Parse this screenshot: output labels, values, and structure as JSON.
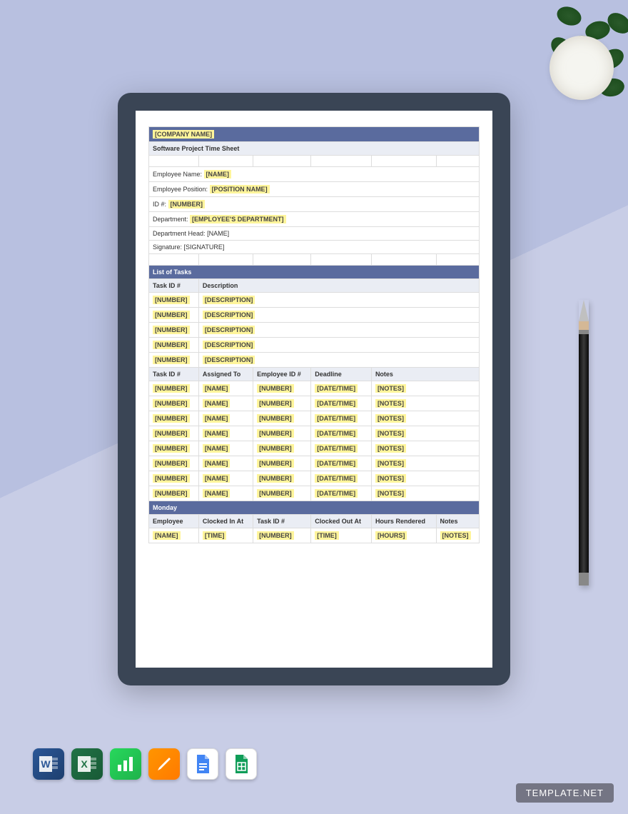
{
  "brand": "TEMPLATE.NET",
  "doc": {
    "company_placeholder": "[COMPANY NAME]",
    "title": "Software Project Time Sheet",
    "fields": [
      {
        "label": "Employee Name:",
        "value": "[NAME]"
      },
      {
        "label": "Employee Position:",
        "value": "[POSITION NAME]"
      },
      {
        "label": "ID #:",
        "value": "[NUMBER]"
      },
      {
        "label": "Department:",
        "value": "[EMPLOYEE'S DEPARTMENT]"
      },
      {
        "label": "Department Head:",
        "value": "[NAME]",
        "plain": true
      },
      {
        "label": "Signature:",
        "value": "[SIGNATURE]",
        "plain": true
      }
    ],
    "tasks_header": "List of Tasks",
    "tasks_cols": [
      "Task ID #",
      "Description"
    ],
    "tasks_rows": [
      {
        "id": "[NUMBER]",
        "desc": "[DESCRIPTION]"
      },
      {
        "id": "[NUMBER]",
        "desc": "[DESCRIPTION]"
      },
      {
        "id": "[NUMBER]",
        "desc": "[DESCRIPTION]"
      },
      {
        "id": "[NUMBER]",
        "desc": "[DESCRIPTION]"
      },
      {
        "id": "[NUMBER]",
        "desc": "[DESCRIPTION]"
      }
    ],
    "assign_cols": [
      "Task ID #",
      "Assigned To",
      "Employee ID #",
      "Deadline",
      "Notes"
    ],
    "assign_rows": [
      {
        "c0": "[NUMBER]",
        "c1": "[NAME]",
        "c2": "[NUMBER]",
        "c3": "[DATE/TIME]",
        "c4": "[NOTES]"
      },
      {
        "c0": "[NUMBER]",
        "c1": "[NAME]",
        "c2": "[NUMBER]",
        "c3": "[DATE/TIME]",
        "c4": "[NOTES]"
      },
      {
        "c0": "[NUMBER]",
        "c1": "[NAME]",
        "c2": "[NUMBER]",
        "c3": "[DATE/TIME]",
        "c4": "[NOTES]"
      },
      {
        "c0": "[NUMBER]",
        "c1": "[NAME]",
        "c2": "[NUMBER]",
        "c3": "[DATE/TIME]",
        "c4": "[NOTES]"
      },
      {
        "c0": "[NUMBER]",
        "c1": "[NAME]",
        "c2": "[NUMBER]",
        "c3": "[DATE/TIME]",
        "c4": "[NOTES]"
      },
      {
        "c0": "[NUMBER]",
        "c1": "[NAME]",
        "c2": "[NUMBER]",
        "c3": "[DATE/TIME]",
        "c4": "[NOTES]"
      },
      {
        "c0": "[NUMBER]",
        "c1": "[NAME]",
        "c2": "[NUMBER]",
        "c3": "[DATE/TIME]",
        "c4": "[NOTES]"
      },
      {
        "c0": "[NUMBER]",
        "c1": "[NAME]",
        "c2": "[NUMBER]",
        "c3": "[DATE/TIME]",
        "c4": "[NOTES]"
      }
    ],
    "day_header": "Monday",
    "day_cols": [
      "Employee",
      "Clocked In At",
      "Task ID #",
      "Clocked Out At",
      "Hours Rendered",
      "Notes"
    ],
    "day_rows": [
      {
        "c0": "[NAME]",
        "c1": "[TIME]",
        "c2": "[NUMBER]",
        "c3": "[TIME]",
        "c4": "[HOURS]",
        "c5": "[NOTES]"
      }
    ]
  },
  "icons": {
    "word": "W",
    "excel": "X",
    "numbers": "",
    "pages": "",
    "docs": "",
    "sheets": ""
  }
}
